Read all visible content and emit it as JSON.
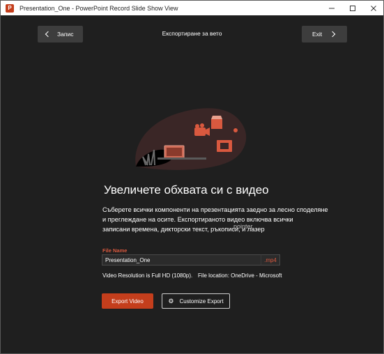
{
  "window": {
    "title": "Presentation_One - PowerPoint Record Slide Show View",
    "app_icon_letter": "P"
  },
  "header": {
    "back_label": "Запис",
    "title": "Експортиране за вето",
    "exit_label": "Exit"
  },
  "main": {
    "heading": "Увеличете обхвата си с видео",
    "description_lines": [
      "Съберете всички компоненти на презентацията заедно за лесно споделяне",
      "и преглеждане на осите. Експортираното видео включва всички",
      "записани времена, дикторски текст, ръкописи, и лазер"
    ],
    "pointer_overlay": "pointer"
  },
  "form": {
    "file_name_label": "File Name",
    "file_name_value": "Presentation_One",
    "extension": ".mp4",
    "resolution_text": "Video Resolution is Full HD (1080p).",
    "location_text": "File location: OneDrive - Microsoft"
  },
  "actions": {
    "export_label": "Export Video",
    "customize_label": "Customize Export"
  },
  "colors": {
    "accent": "#c43e1c",
    "label_accent": "#d9593f",
    "background": "#1f1f1f"
  },
  "icons": [
    "powerpoint-app-icon",
    "minimize-icon",
    "maximize-icon",
    "close-icon",
    "chevron-left-icon",
    "chevron-right-icon",
    "gear-icon"
  ]
}
